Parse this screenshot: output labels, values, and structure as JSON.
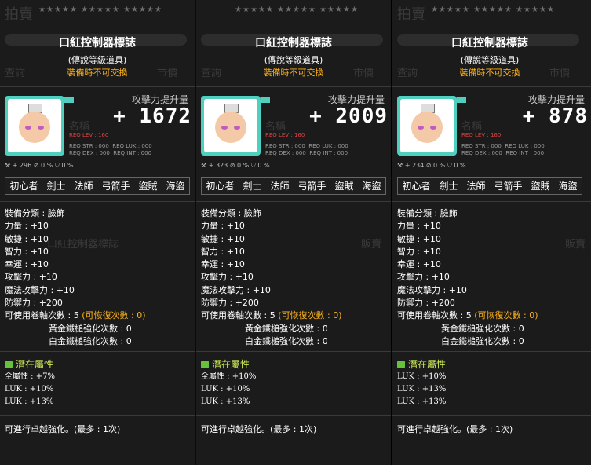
{
  "bg": {
    "auction": "拍賣",
    "search": "查詢",
    "market": "市價",
    "name": "名稱",
    "sell": "販賣"
  },
  "stars": "★★★★★ ★★★★★ ★★★★★",
  "title": "口紅控制器標誌",
  "subtitle": "(傳說等級道具)",
  "trade": "裝備時不可交換",
  "attack_label": "攻擊力提升量",
  "req": {
    "lev": "REQ LEV : 160",
    "str": "REQ STR : 000",
    "luk": "REQ LUK : 000",
    "dex": "REQ DEX : 000",
    "int": "REQ INT : 000"
  },
  "jobs": [
    "初心者",
    "劍士",
    "法師",
    "弓箭手",
    "盜賊",
    "海盜"
  ],
  "stats": {
    "category": "裝備分類 : 臉飾",
    "str": "力量 : +10",
    "dex": "敏捷 : +10",
    "int": "智力 : +10",
    "luk": "幸運 : +10",
    "atk": "攻擊力 : +10",
    "matk": "魔法攻擊力 : +10",
    "def": "防禦力 : +200",
    "scroll": "可使用卷軸次數 : 5",
    "scroll_restore": "(可恢復次數 : 0)",
    "gold": "黃金鐵槌強化次數 : 0",
    "platinum": "白金鐵槌強化次數 : 0"
  },
  "potential_title": "潛在屬性",
  "footer": "可進行卓越強化。(最多 : 1次)",
  "panels": [
    {
      "attack_value": "+ 1672",
      "icon_row": "⚒ + 296  ⊘ 0 %  ⛉ 0 %",
      "potential": [
        "全屬性 : +7%",
        "LUK : +10%",
        "LUK : +13%"
      ]
    },
    {
      "attack_value": "+ 2009",
      "icon_row": "⚒ + 323  ⊘ 0 %  ⛉ 0 %",
      "potential": [
        "全屬性 : +10%",
        "LUK : +10%",
        "LUK : +13%"
      ]
    },
    {
      "attack_value": "+ 878",
      "icon_row": "⚒ + 234  ⊘ 0 %  ⛉ 0 %",
      "potential": [
        "LUK : +10%",
        "LUK : +13%",
        "LUK : +13%"
      ]
    }
  ]
}
